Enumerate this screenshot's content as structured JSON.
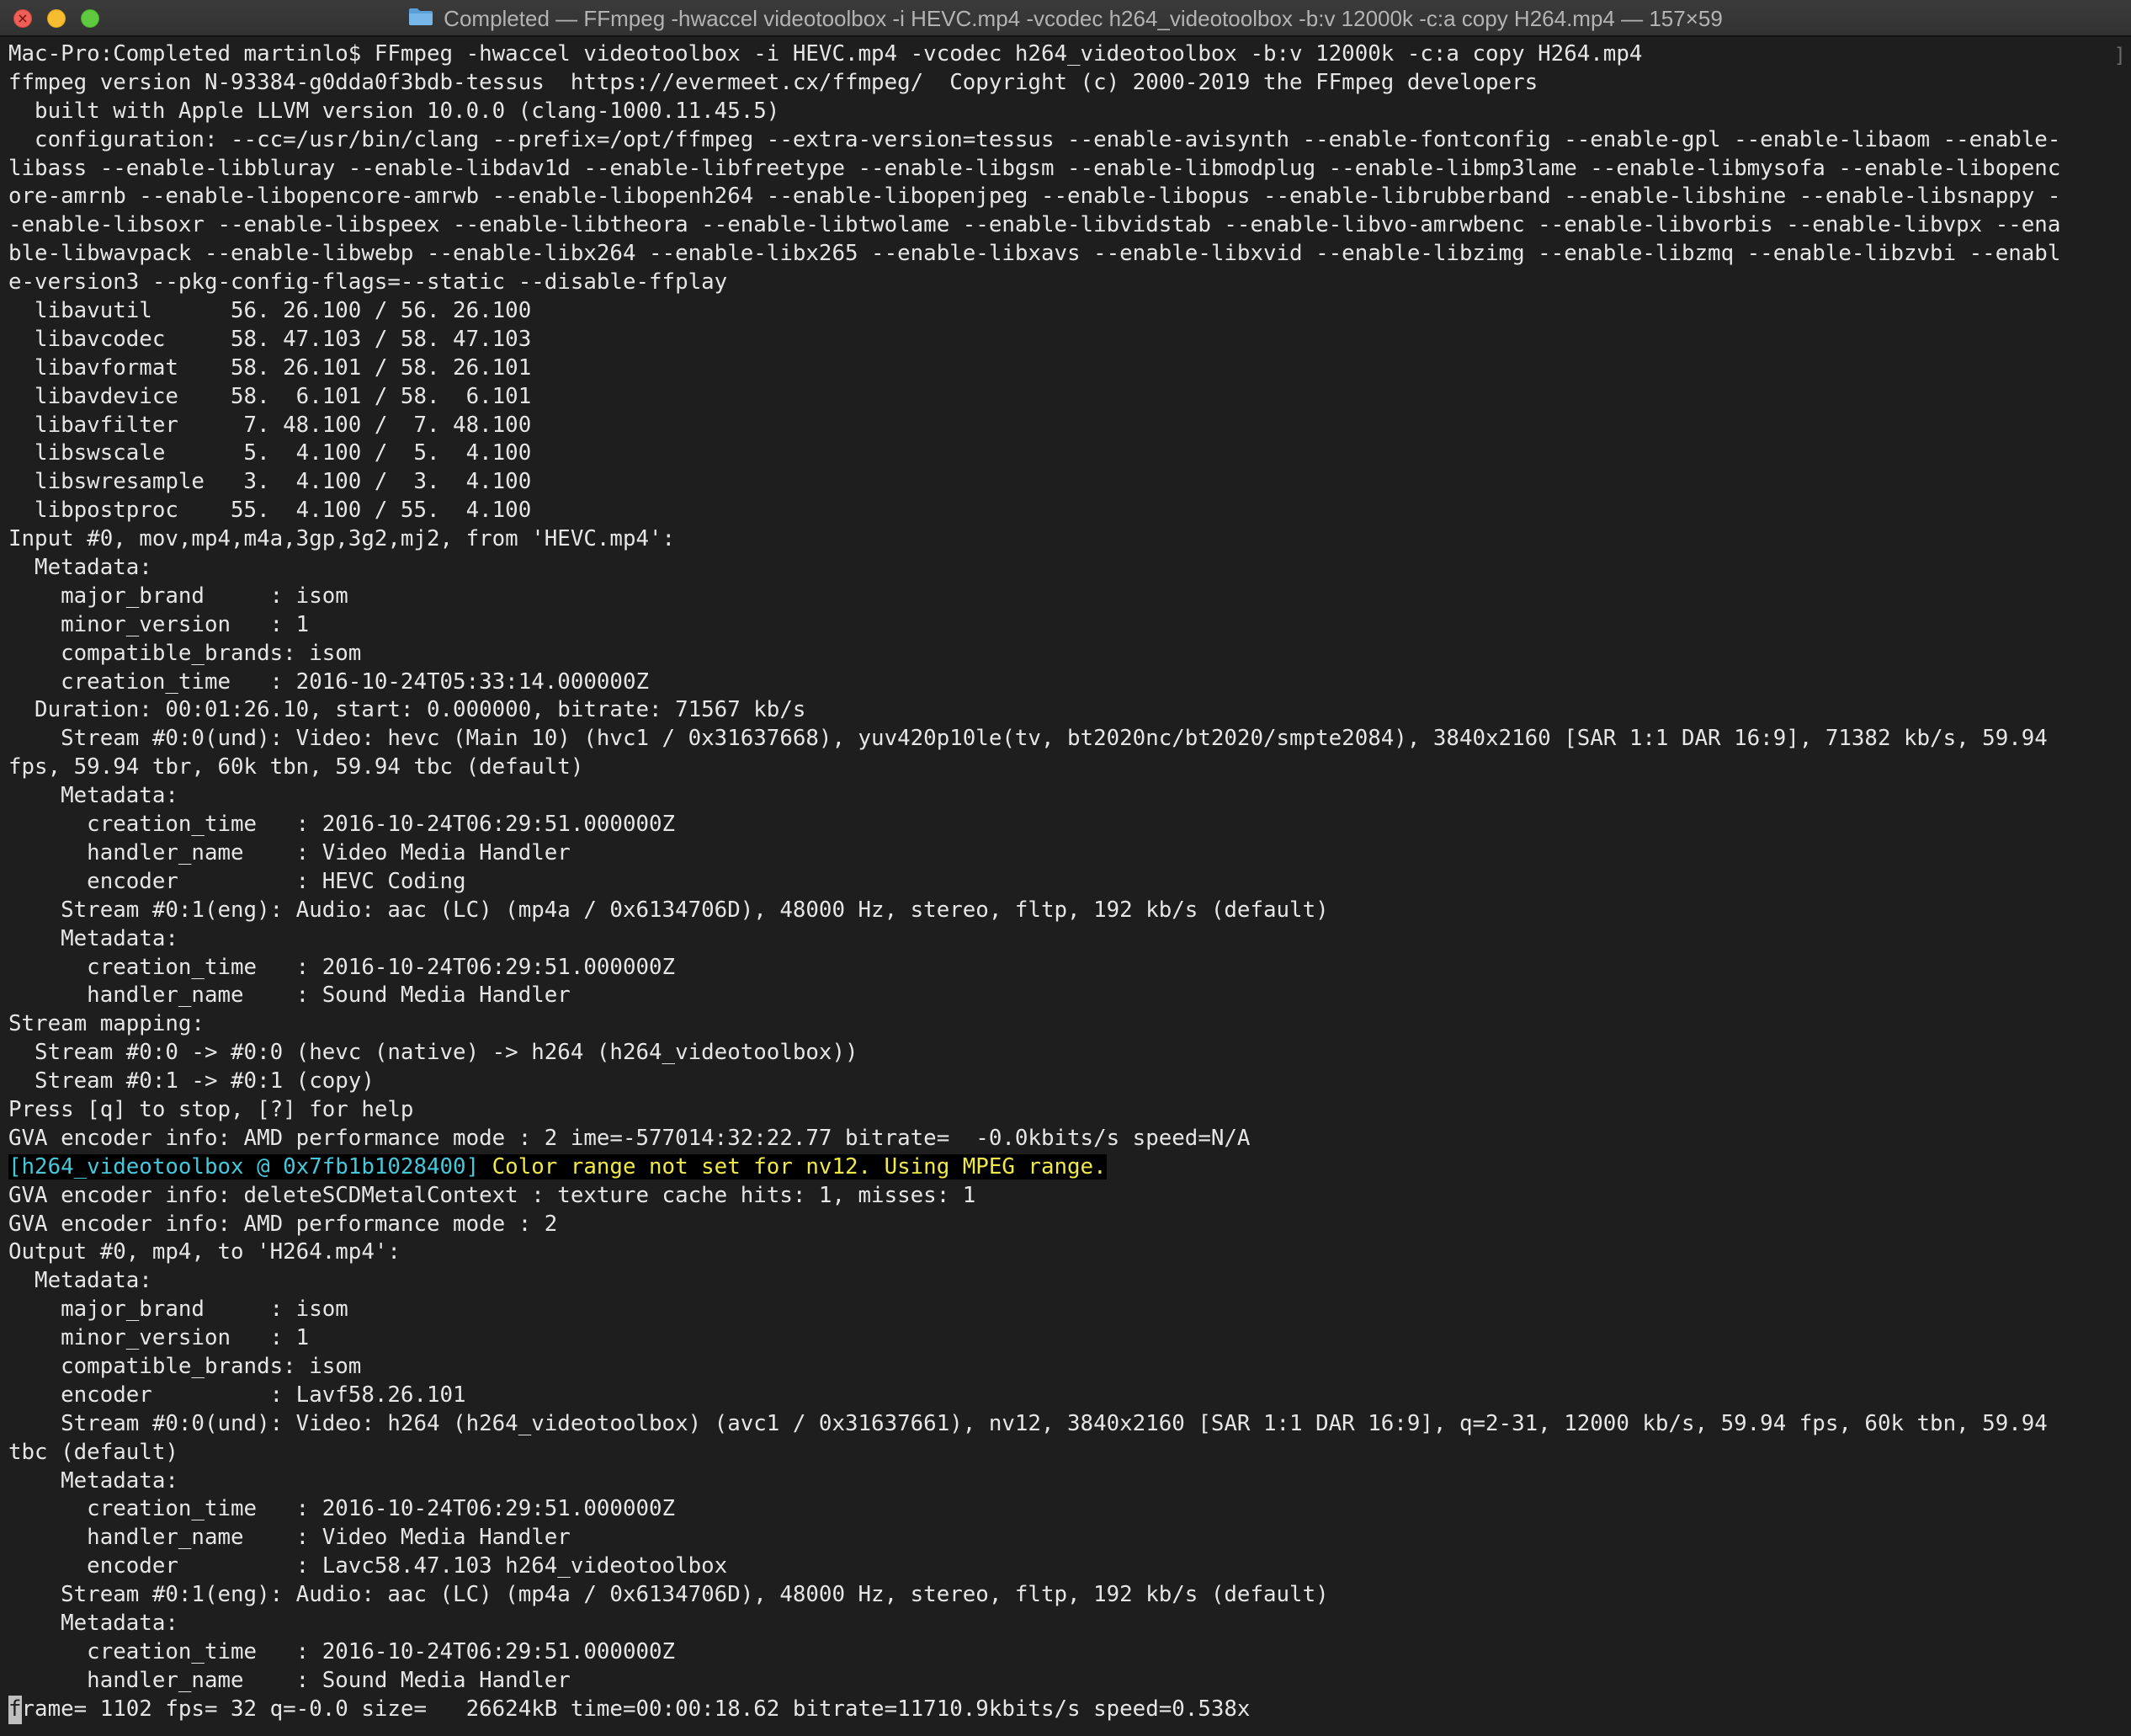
{
  "window": {
    "title": "Completed — FFmpeg -hwaccel videotoolbox -i HEVC.mp4 -vcodec h264_videotoolbox -b:v 12000k -c:a copy H264.mp4 — 157×59",
    "folder_icon": "folder-icon",
    "colors": {
      "background": "#1e1e1e",
      "text": "#e6e6e6",
      "warning_tag": "#46c8dc",
      "warning_text": "#f0e84a"
    }
  },
  "terminal": {
    "lines": [
      "Mac-Pro:Completed martinlo$ FFmpeg -hwaccel videotoolbox -i HEVC.mp4 -vcodec h264_videotoolbox -b:v 12000k -c:a copy H264.mp4",
      "ffmpeg version N-93384-g0dda0f3bdb-tessus  https://evermeet.cx/ffmpeg/  Copyright (c) 2000-2019 the FFmpeg developers",
      "  built with Apple LLVM version 10.0.0 (clang-1000.11.45.5)",
      "  configuration: --cc=/usr/bin/clang --prefix=/opt/ffmpeg --extra-version=tessus --enable-avisynth --enable-fontconfig --enable-gpl --enable-libaom --enable-",
      "libass --enable-libbluray --enable-libdav1d --enable-libfreetype --enable-libgsm --enable-libmodplug --enable-libmp3lame --enable-libmysofa --enable-libopenc",
      "ore-amrnb --enable-libopencore-amrwb --enable-libopenh264 --enable-libopenjpeg --enable-libopus --enable-librubberband --enable-libshine --enable-libsnappy -",
      "-enable-libsoxr --enable-libspeex --enable-libtheora --enable-libtwolame --enable-libvidstab --enable-libvo-amrwbenc --enable-libvorbis --enable-libvpx --ena",
      "ble-libwavpack --enable-libwebp --enable-libx264 --enable-libx265 --enable-libxavs --enable-libxvid --enable-libzimg --enable-libzmq --enable-libzvbi --enabl",
      "e-version3 --pkg-config-flags=--static --disable-ffplay",
      "  libavutil      56. 26.100 / 56. 26.100",
      "  libavcodec     58. 47.103 / 58. 47.103",
      "  libavformat    58. 26.101 / 58. 26.101",
      "  libavdevice    58.  6.101 / 58.  6.101",
      "  libavfilter     7. 48.100 /  7. 48.100",
      "  libswscale      5.  4.100 /  5.  4.100",
      "  libswresample   3.  4.100 /  3.  4.100",
      "  libpostproc    55.  4.100 / 55.  4.100",
      "Input #0, mov,mp4,m4a,3gp,3g2,mj2, from 'HEVC.mp4':",
      "  Metadata:",
      "    major_brand     : isom",
      "    minor_version   : 1",
      "    compatible_brands: isom",
      "    creation_time   : 2016-10-24T05:33:14.000000Z",
      "  Duration: 00:01:26.10, start: 0.000000, bitrate: 71567 kb/s",
      "    Stream #0:0(und): Video: hevc (Main 10) (hvc1 / 0x31637668), yuv420p10le(tv, bt2020nc/bt2020/smpte2084), 3840x2160 [SAR 1:1 DAR 16:9], 71382 kb/s, 59.94",
      "fps, 59.94 tbr, 60k tbn, 59.94 tbc (default)",
      "    Metadata:",
      "      creation_time   : 2016-10-24T06:29:51.000000Z",
      "      handler_name    : Video Media Handler",
      "      encoder         : HEVC Coding",
      "    Stream #0:1(eng): Audio: aac (LC) (mp4a / 0x6134706D), 48000 Hz, stereo, fltp, 192 kb/s (default)",
      "    Metadata:",
      "      creation_time   : 2016-10-24T06:29:51.000000Z",
      "      handler_name    : Sound Media Handler",
      "Stream mapping:",
      "  Stream #0:0 -> #0:0 (hevc (native) -> h264 (h264_videotoolbox))",
      "  Stream #0:1 -> #0:1 (copy)",
      "Press [q] to stop, [?] for help",
      "GVA encoder info: AMD performance mode : 2 ime=-577014:32:22.77 bitrate=  -0.0kbits/s speed=N/A"
    ],
    "warning": {
      "tag": "[h264_videotoolbox @ 0x7fb1b1028400]",
      "message": " Color range not set for nv12. Using MPEG range."
    },
    "lines_after": [
      "GVA encoder info: deleteSCDMetalContext : texture cache hits: 1, misses: 1",
      "GVA encoder info: AMD performance mode : 2",
      "Output #0, mp4, to 'H264.mp4':",
      "  Metadata:",
      "    major_brand     : isom",
      "    minor_version   : 1",
      "    compatible_brands: isom",
      "    encoder         : Lavf58.26.101",
      "    Stream #0:0(und): Video: h264 (h264_videotoolbox) (avc1 / 0x31637661), nv12, 3840x2160 [SAR 1:1 DAR 16:9], q=2-31, 12000 kb/s, 59.94 fps, 60k tbn, 59.94",
      "tbc (default)",
      "    Metadata:",
      "      creation_time   : 2016-10-24T06:29:51.000000Z",
      "      handler_name    : Video Media Handler",
      "      encoder         : Lavc58.47.103 h264_videotoolbox",
      "    Stream #0:1(eng): Audio: aac (LC) (mp4a / 0x6134706D), 48000 Hz, stereo, fltp, 192 kb/s (default)",
      "    Metadata:",
      "      creation_time   : 2016-10-24T06:29:51.000000Z",
      "      handler_name    : Sound Media Handler"
    ],
    "progress": {
      "cursor_char": "f",
      "rest": "rame= 1102 fps= 32 q=-0.0 size=   26624kB time=00:00:18.62 bitrate=11710.9kbits/s speed=0.538x"
    }
  }
}
